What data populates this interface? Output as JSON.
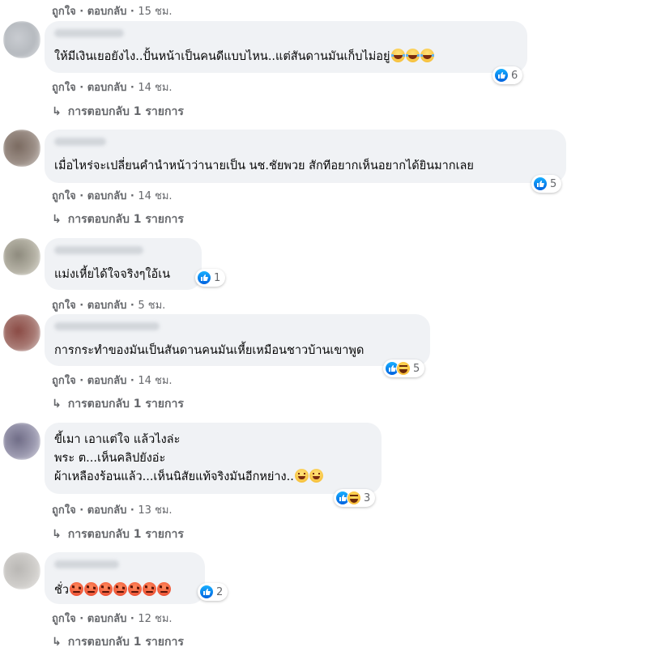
{
  "labels": {
    "like": "ถูกใจ",
    "reply": "ตอบกลับ",
    "dot": "·",
    "view_replies": "การตอบกลับ 1 รายการ"
  },
  "top_meta": {
    "time": "15 ชม."
  },
  "comments": [
    {
      "text": "ให้มีเงินเยอยังไง..ปั้นหน้าเป็นคนดีแบบไหน..แต่สันดานมันเก็บไม่อยู่",
      "reaction_count": "6",
      "reactions": [
        "like"
      ],
      "time": "14 ชม.",
      "has_replies": true
    },
    {
      "text": "เมื่อไหร่จะเปลี่ยนคำนำหน้าว่านายเป็น นช.ชัยพวย สักทีอยากเห็นอยากได้ยินมากเลย",
      "reaction_count": "5",
      "reactions": [
        "like"
      ],
      "time": "14 ชม.",
      "has_replies": true
    },
    {
      "text": "แม่งเหี้ยได้ใจจริงๆใอ้เน",
      "reaction_count": "1",
      "reactions": [
        "like"
      ],
      "time": "5 ชม.",
      "has_replies": false
    },
    {
      "text": "การกระทำของมันเป็นสันดานคนมันเหี้ยเหมือนชาวบ้านเขาพูด",
      "reaction_count": "5",
      "reactions": [
        "like",
        "haha"
      ],
      "time": "14 ชม.",
      "has_replies": true
    },
    {
      "lines": [
        "ขี้เมา เอาแต่ใจ แล้วไงล่ะ",
        "พระ ต...เห็นคลิปยังอ่ะ",
        "ผ้าเหลืองร้อนแล้ว...เห็นนิสัยแท้จริงมันอีกหย่าง.."
      ],
      "reaction_count": "3",
      "reactions": [
        "like",
        "haha"
      ],
      "time": "13 ชม.",
      "has_replies": true
    },
    {
      "text": "ชั่ว",
      "reaction_count": "2",
      "reactions": [
        "like"
      ],
      "time": "12 ชม.",
      "has_replies": true
    }
  ],
  "colors": {
    "bubble": "#f0f2f5",
    "meta": "#65676b",
    "like_blue": "#1877f2"
  }
}
